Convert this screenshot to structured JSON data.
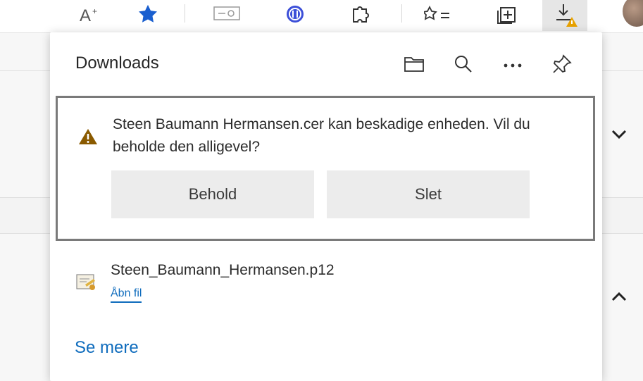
{
  "toolbar": {
    "icons": [
      "text-size-icon",
      "favorite-star-icon",
      "reading-view-icon",
      "extension-icon",
      "puzzle-icon",
      "favorites-list-icon",
      "collections-icon",
      "downloads-warning-icon"
    ]
  },
  "downloads": {
    "title": "Downloads",
    "warning": {
      "message": "Steen Baumann Hermansen.cer kan beskadige enheden. Vil du beholde den alligevel?",
      "keep_label": "Behold",
      "delete_label": "Slet"
    },
    "file": {
      "name": "Steen_Baumann_Hermansen.p12",
      "action": "Åbn fil"
    },
    "see_more": "Se mere"
  },
  "colors": {
    "accent": "#0f6cbd",
    "warning": "#8a5a00",
    "star": "#1a5fcf"
  }
}
